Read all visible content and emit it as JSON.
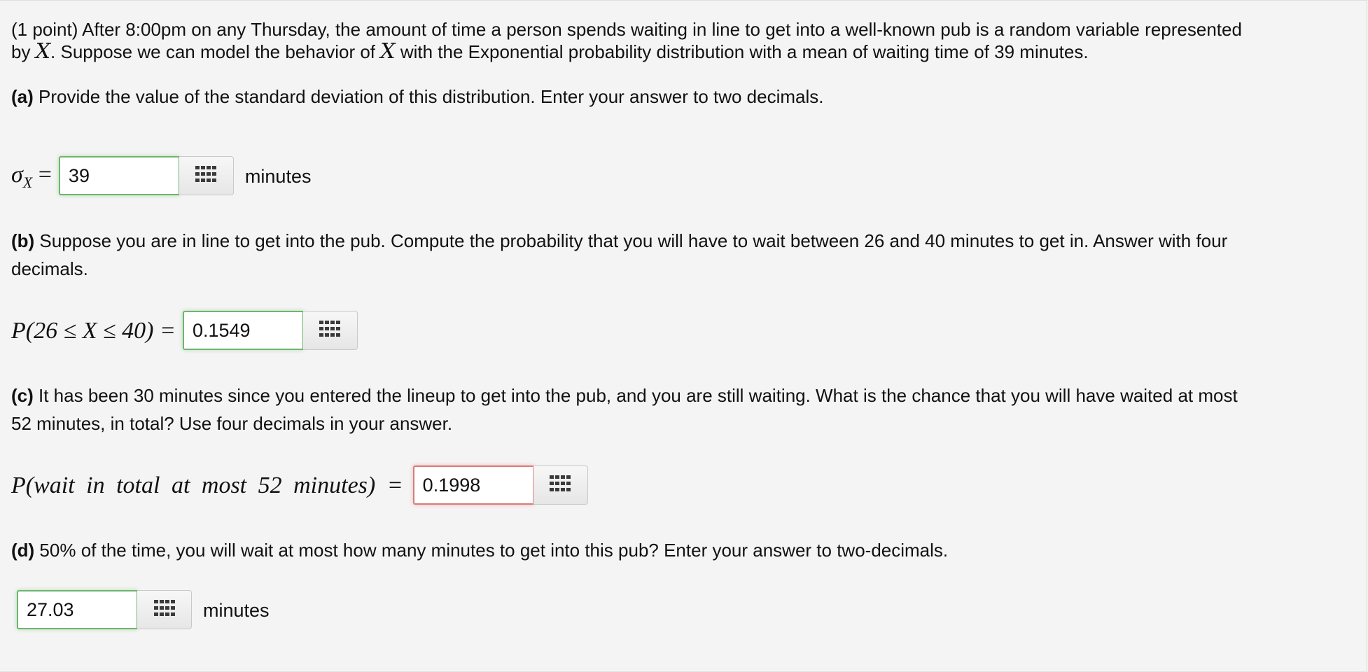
{
  "problem": {
    "intro_line1": "(1 point) After 8:00pm on any Thursday, the amount of time a person spends waiting in line to get into a well-known pub is a random variable represented",
    "intro_line2_a": "by ",
    "intro_var_1": "X",
    "intro_line2_b": ". Suppose we can model the behavior of ",
    "intro_var_2": "X",
    "intro_line2_c": " with the Exponential probability distribution with a mean of waiting time of 39 minutes."
  },
  "parts": [
    {
      "label": "(a)",
      "text": " Provide the value of the standard deviation of this distribution. Enter your answer to two decimals.",
      "math_sym": "σ",
      "math_sub": "X",
      "math_rest": " =",
      "value": "39",
      "status": "correct",
      "unit": "minutes",
      "palette_icon": "keypad-grid-icon"
    },
    {
      "label": "(b)",
      "text": " Suppose you are in line to get into the pub. Compute the probability that you will have to wait between 26 and 40 minutes to get in. Answer with four",
      "text_line2": "decimals.",
      "math": "P(26 ≤ X ≤ 40) =",
      "value": "0.1549",
      "status": "correct",
      "palette_icon": "keypad-grid-icon"
    },
    {
      "label": "(c)",
      "text": " It has been 30 minutes since you entered the lineup to get into the pub, and you are still waiting. What is the chance that you will have waited at most",
      "text_line2": "52 minutes, in total? Use four decimals in your answer.",
      "math": "P(wait in total at most 52 minutes) =",
      "value": "0.1998",
      "status": "incorrect",
      "palette_icon": "keypad-grid-icon"
    },
    {
      "label": "(d)",
      "text": " 50% of the time, you will wait at most how many minutes to get into this pub? Enter your answer to two-decimals.",
      "value": "27.03",
      "status": "correct",
      "unit": "minutes",
      "palette_icon": "keypad-grid-icon"
    }
  ],
  "colors": {
    "background": "#f4f4f4",
    "correct_border": "#6fb56f",
    "incorrect_border": "#d97b7b"
  }
}
